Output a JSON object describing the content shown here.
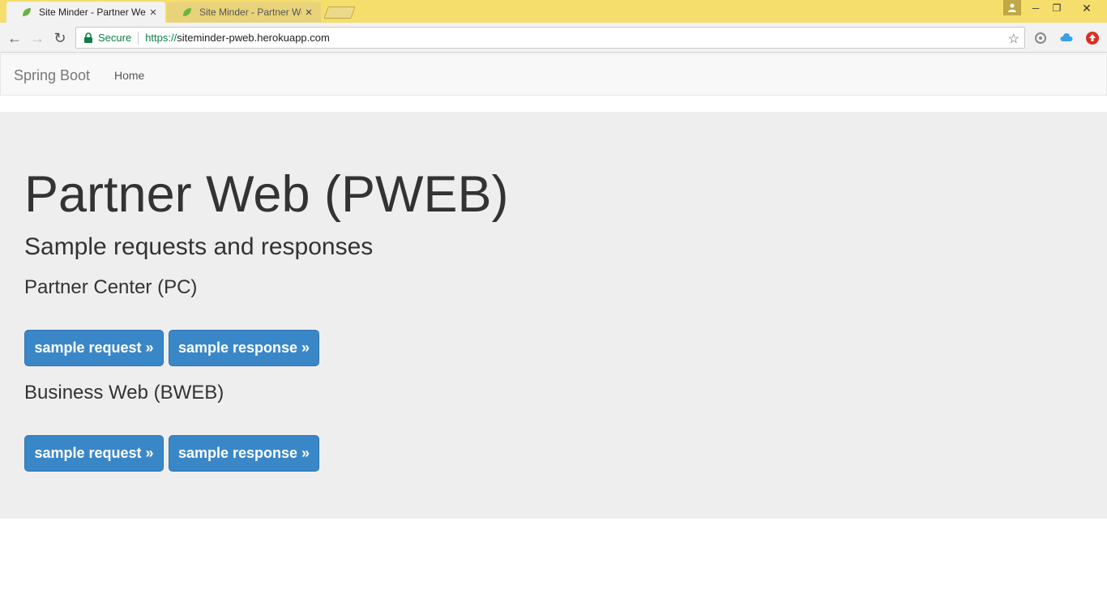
{
  "browser": {
    "tabs": [
      {
        "title": "Site Minder - Partner We",
        "close": "×"
      },
      {
        "title": "Site Minder - Partner We",
        "close": "×"
      }
    ],
    "window_controls": {
      "minimize": "─",
      "restore": "❐",
      "close": "✕"
    },
    "nav": {
      "back": "←",
      "forward": "→",
      "reload": "↻"
    },
    "address": {
      "secure_label": "Secure",
      "scheme": "https://",
      "host": "siteminder-pweb.herokuapp.com"
    },
    "star": "☆"
  },
  "page": {
    "navbar": {
      "brand": "Spring Boot",
      "home": "Home"
    },
    "heading": "Partner Web (PWEB)",
    "subheading": "Sample requests and responses",
    "sections": [
      {
        "title": "Partner Center (PC)",
        "request_btn": "sample request »",
        "response_btn": "sample response »"
      },
      {
        "title": "Business Web (BWEB)",
        "request_btn": "sample request »",
        "response_btn": "sample response »"
      }
    ]
  },
  "colors": {
    "titlebar": "#f5de6b",
    "button": "#3a87c8",
    "jumbotron": "#eeeeee"
  }
}
